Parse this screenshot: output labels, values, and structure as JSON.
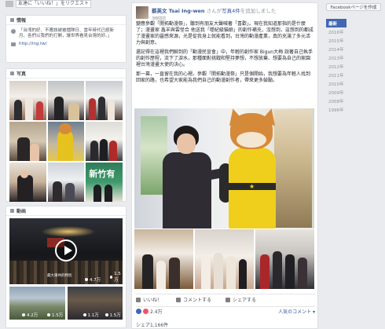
{
  "invite": {
    "label": "友達に「いいね！」をリクエスト"
  },
  "info": {
    "title": "情報",
    "description": "「台湾的好、不應該被被擋隊日、當年時代已經新月、各們以我們的打開，讓世界看見台灣的好。」",
    "link": "http://ing.tw/"
  },
  "photos": {
    "title": "写真"
  },
  "videos": {
    "title": "動画",
    "main_caption": "最大東共的特別",
    "main_views": "4.7万",
    "main_duration": "1.5万",
    "small1_views": "4.2万",
    "small1_duration": "1.5万",
    "small2_views": "1.1万",
    "small2_duration": "1.5万"
  },
  "post": {
    "author": "蔡英文 Tsai Ing-wen",
    "action_prefix": "さんが",
    "action_link": "写真4件",
    "action_suffix": "を追加しました",
    "timestamp": "3時間前",
    "body": [
      "變應參觀「開拓動漫祭」，聽到有朋友大聲喊著「喜歡」。現在我知道那指的是什麼了；漫畫家 鑫羊與雲怪合 他送我「穩紀級貓娘」的創作補充，沒想到，這想到的都成了漫畫家的靈感來源，光是從我身上就能看到，台灣的動漫產業，真的充滿了多元活力與創意。",
      "還記得在這裡我們聊到的「動漫民宣會」中，年輕的創作家 Bigun大梅 說著自己執手的創作歷程，流下了淚水，那種面對挑戰和堅持夢想，不想放棄、想要為自己的家園裡台灣漫畫大使的決心。",
      "那一幕，一直留在我的心裡。參觀「開拓動漫祭」只是個開始，我想要為年輕人找到回家的路，也希望大家能為我們自己的動漫創作者，帶來更多鼓勵。"
    ],
    "like_label": "いいね！",
    "comment_label": "コメントする",
    "share_label": "シェアする",
    "reaction_count": "2.4万",
    "popular_comments": "人気のコメント ▾",
    "shares": "シェア1,166件"
  },
  "right": {
    "create_page_label": "Facebookページを作成",
    "timeline": [
      "最新",
      "2016年",
      "2015年",
      "2014年",
      "2013年",
      "2012年",
      "2011年",
      "2010年",
      "2009年",
      "2008年",
      "1996年"
    ]
  },
  "colors": {
    "brand": "#4267b2",
    "link": "#365899",
    "background": "#e9ebee",
    "heart": "#f25268"
  }
}
